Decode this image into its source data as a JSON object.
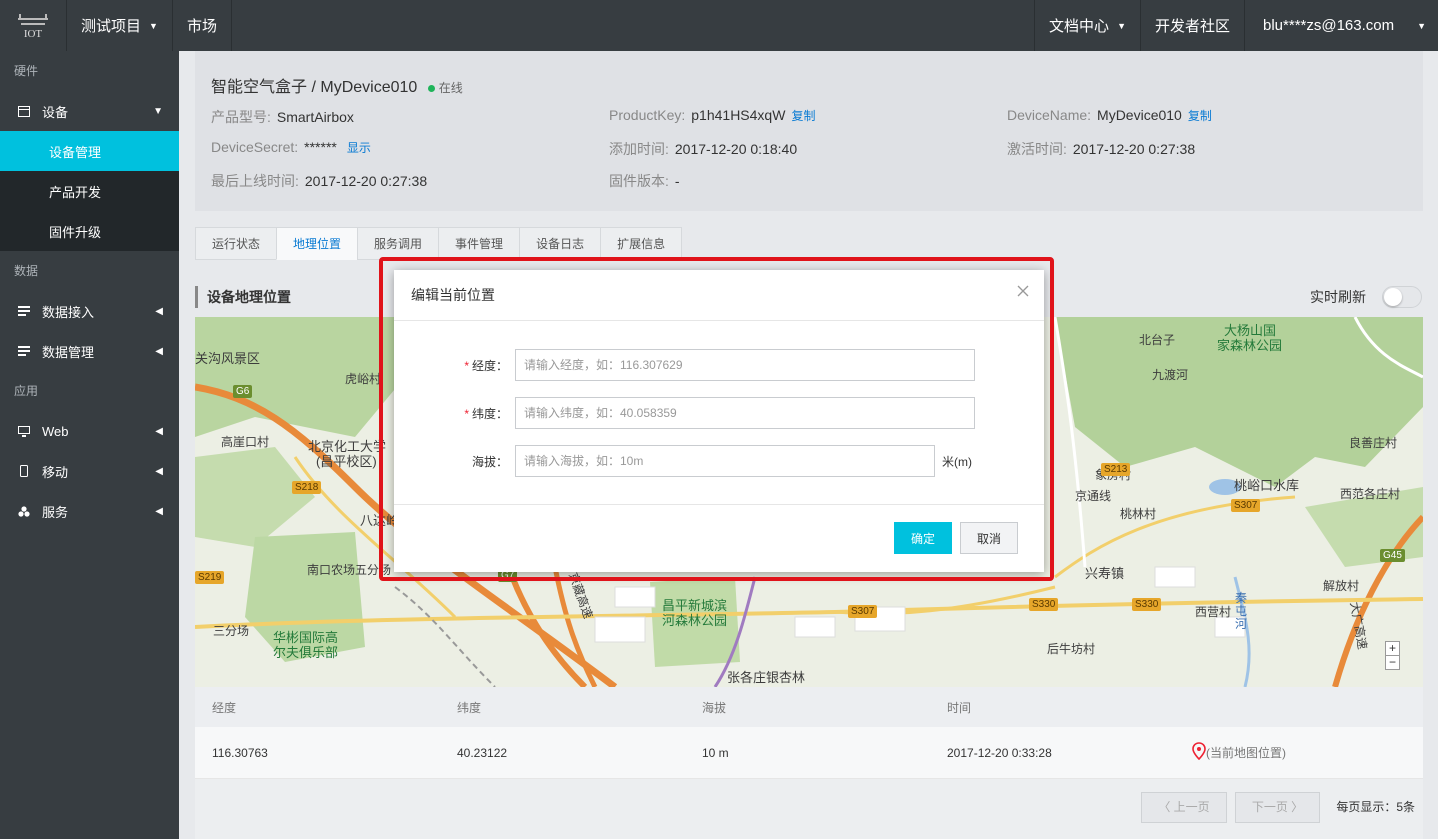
{
  "topbar": {
    "logo_icon": "iot-logo-icon",
    "project": "测试项目",
    "market": "市场",
    "docs": "文档中心",
    "community": "开发者社区",
    "account": "blu****zs@163.com"
  },
  "sidebar": {
    "group_hardware": "硬件",
    "device": "设备",
    "device_manage": "设备管理",
    "product_dev": "产品开发",
    "firmware": "固件升级",
    "group_data": "数据",
    "data_access": "数据接入",
    "data_manage": "数据管理",
    "group_app": "应用",
    "web": "Web",
    "mobile": "移动",
    "service": "服务"
  },
  "device": {
    "name": "智能空气盒子",
    "id": "MyDevice010",
    "status": "在线",
    "model_label": "产品型号:",
    "model": "SmartAirbox",
    "pk_label": "ProductKey:",
    "pk": "p1h41HS4xqW",
    "copy": "复制",
    "dn_label": "DeviceName:",
    "dn": "MyDevice010",
    "secret_label": "DeviceSecret:",
    "secret": "******",
    "show": "显示",
    "added_label": "添加时间:",
    "added": "2017-12-20 0:18:40",
    "activated_label": "激活时间:",
    "activated": "2017-12-20 0:27:38",
    "last_online_label": "最后上线时间:",
    "last_online": "2017-12-20 0:27:38",
    "fw_label": "固件版本:",
    "fw": "-"
  },
  "tabs": [
    "运行状态",
    "地理位置",
    "服务调用",
    "事件管理",
    "设备日志",
    "扩展信息"
  ],
  "location": {
    "title": "设备地理位置",
    "realtime": "实时刷新"
  },
  "map_labels": {
    "l1": "关沟风景区",
    "l2": "虎峪村",
    "l3": "北京化工大学",
    "l4": "(昌平校区)",
    "l5": "高崖口村",
    "l6": "八达岭",
    "l7": "南口农场五分场",
    "l8": "三分场",
    "l9": "华彬国际高",
    "l10": "尔夫俱乐部",
    "l11": "京藏高速",
    "l12": "昌平新城滨",
    "l13": "河森林公园",
    "l14": "张各庄银杏林",
    "l15": "北台子",
    "l16": "大杨山国",
    "l17": "家森林公园",
    "l18": "九渡河",
    "l19": "良善庄村",
    "l20": "象房村",
    "l21": "京通线",
    "l22": "桃峪口水库",
    "l23": "西范各庄村",
    "l24": "桃林村",
    "l25": "兴寿镇",
    "l26": "西营村",
    "l27": "解放村",
    "l28": "后牛坊村",
    "l29": "秦屯河",
    "l30": "大广高速",
    "r1": "G6",
    "r2": "S218",
    "r3": "S219",
    "r4": "G7",
    "r5": "S307",
    "r6": "S330",
    "r7": "S330",
    "r8": "S213",
    "r9": "S307",
    "r10": "G45",
    "zoom_in": "+",
    "zoom_out": "−"
  },
  "table": {
    "headers": [
      "经度",
      "纬度",
      "海拔",
      "时间"
    ],
    "row": {
      "lng": "116.30763",
      "lat": "40.23122",
      "alt": "10 m",
      "time": "2017-12-20 0:33:28",
      "pin": "(当前地图位置)"
    }
  },
  "pager": {
    "prev": "上一页",
    "next": "下一页",
    "info": "每页显示：5条"
  },
  "modal": {
    "title": "编辑当前位置",
    "lng_label": "经度：",
    "lng_placeholder": "请输入经度，如：116.307629",
    "lat_label": "纬度：",
    "lat_placeholder": "请输入纬度，如：40.058359",
    "alt_label": "海拔：",
    "alt_placeholder": "请输入海拔，如：10m",
    "alt_unit": "米(m)",
    "required_mark": "*",
    "ok": "确定",
    "cancel": "取消"
  },
  "colors": {
    "accent": "#00c1de",
    "highlight": "#e0131a",
    "online": "#1fb45a",
    "link": "#0a7bd3"
  }
}
